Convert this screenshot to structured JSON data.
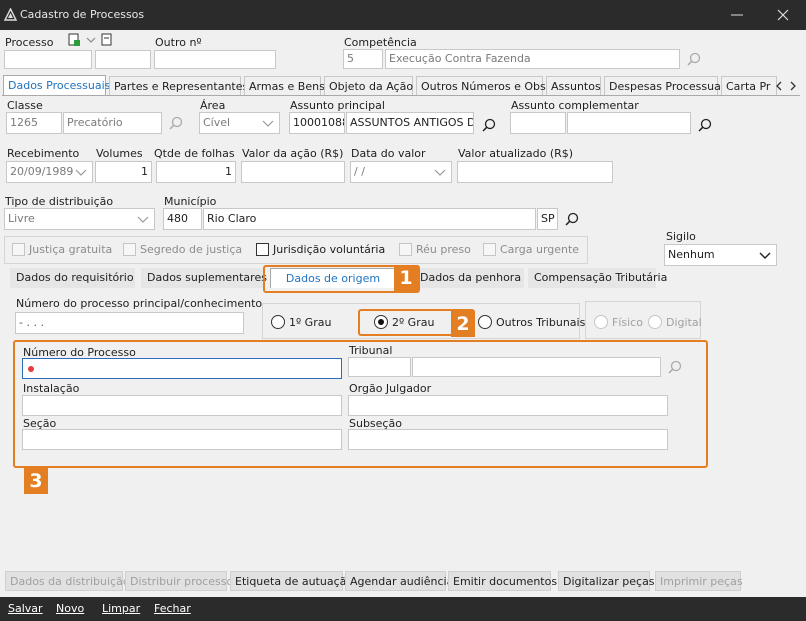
{
  "window": {
    "title": "Cadastro de Processos"
  },
  "header": {
    "processo_label": "Processo",
    "outro_label": "Outro nº",
    "competencia_label": "Competência",
    "competencia_code": "5",
    "competencia_name": "Execução Contra Fazenda"
  },
  "tabs": [
    "Dados Processuais",
    "Partes e Representantes",
    "Armas e Bens",
    "Objeto da Ação",
    "Outros Números e Obs.",
    "Assuntos",
    "Despesas Processuais",
    "Carta Pr"
  ],
  "form": {
    "classe_label": "Classe",
    "classe_code": "1265",
    "classe_name": "Precatório",
    "area_label": "Área",
    "area_value": "Cível",
    "assunto_principal_label": "Assunto principal",
    "assunto_principal_code": "10001088",
    "assunto_principal_name": "ASSUNTOS ANTIGOS DO",
    "assunto_complementar_label": "Assunto complementar",
    "recebimento_label": "Recebimento",
    "recebimento_value": "20/09/1989",
    "volumes_label": "Volumes",
    "volumes_value": "1",
    "folhas_label": "Qtde de folhas",
    "folhas_value": "1",
    "valor_acao_label": "Valor da ação (R$)",
    "data_valor_label": "Data do valor",
    "data_valor_value": " /  /",
    "valor_atualizado_label": "Valor atualizado (R$)",
    "tipo_dist_label": "Tipo de distribuição",
    "tipo_dist_value": "Livre",
    "municipio_label": "Município",
    "municipio_code": "480",
    "municipio_name": "Rio Claro",
    "municipio_uf": "SP",
    "justica_gratuita": "Justiça gratuita",
    "segredo_justica": "Segredo de justiça",
    "jurisdicao_voluntaria": "Jurisdição voluntária",
    "reu_preso": "Réu preso",
    "carga_urgente": "Carga urgente",
    "sigilo_label": "Sigilo",
    "sigilo_value": "Nenhum"
  },
  "subtabs": [
    "Dados do requisitório",
    "Dados suplementares",
    "Dados de origem",
    "Dados da penhora",
    "Compensação Tributária"
  ],
  "origem": {
    "num_principal_label": "Número do processo principal/conhecimento",
    "num_principal_value": "- . . .",
    "grau1": "1º Grau",
    "grau2": "2º Grau",
    "outros": "Outros Tribunais",
    "fisico": "Físico",
    "digital": "Digital",
    "numero_processo_label": "Número do Processo",
    "tribunal_label": "Tribunal",
    "instalacao_label": "Instalação",
    "orgao_label": "Orgão Julgador",
    "secao_label": "Seção",
    "subsecao_label": "Subseção"
  },
  "badges": [
    "1",
    "2",
    "3"
  ],
  "buttons": [
    "Dados da distribuição",
    "Distribuir processo",
    "Etiqueta de autuação",
    "Agendar audiência",
    "Emitir documentos",
    "Digitalizar peças",
    "Imprimir peças"
  ],
  "footer": [
    "Salvar",
    "Novo",
    "Limpar",
    "Fechar"
  ],
  "colors": {
    "accent": "#e37e22",
    "titlebar": "#2b2b2b",
    "tab_active": "#1e73be"
  }
}
